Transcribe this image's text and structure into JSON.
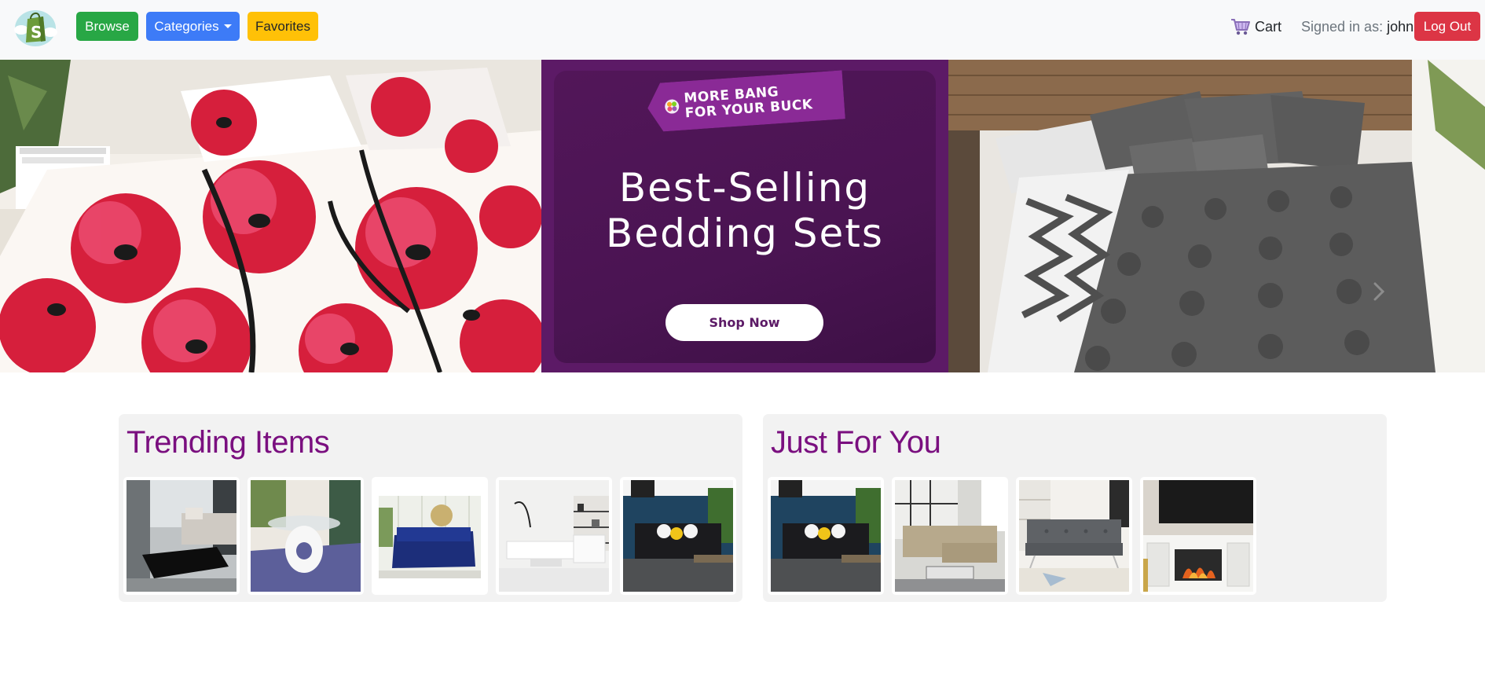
{
  "navbar": {
    "logo_icon": "shopping-bag-s-logo-icon",
    "browse_label": "Browse",
    "categories_label": "Categories",
    "favorites_label": "Favorites",
    "cart_label": "Cart",
    "cart_icon": "shopping-cart-icon",
    "signed_in_prefix": "Signed in as:",
    "username": "john",
    "logout_label": "Log Out"
  },
  "hero": {
    "tag_line1": "MORE BANG",
    "tag_line2": "FOR YOUR BUCK",
    "headline_line1": "Best-Selling",
    "headline_line2": "Bedding Sets",
    "cta_label": "Shop Now",
    "next_icon": "chevron-right-icon",
    "colors": {
      "banner_purple": "#5c1a66",
      "flower_red": "#d61f3c"
    }
  },
  "sections": {
    "trending": {
      "title": "Trending Items",
      "items": [
        {
          "image": "gray-sofa-black-coffee-table"
        },
        {
          "image": "white-oval-table-purple-rug"
        },
        {
          "image": "navy-velvet-sofa"
        },
        {
          "image": "white-sectional-living-room"
        },
        {
          "image": "black-sofa-yellow-pillow"
        }
      ]
    },
    "foryou": {
      "title": "Just For You",
      "items": [
        {
          "image": "black-sofa-yellow-pillow"
        },
        {
          "image": "beige-sectional-sofa"
        },
        {
          "image": "gray-tufted-futon"
        },
        {
          "image": "white-fireplace-tv-stand"
        }
      ]
    }
  },
  "colors": {
    "section_title": "#7a0f7f",
    "browse_green": "#28a745",
    "categories_blue": "#3d7bf7",
    "favorites_yellow": "#ffc107",
    "logout_red": "#dc3545"
  }
}
